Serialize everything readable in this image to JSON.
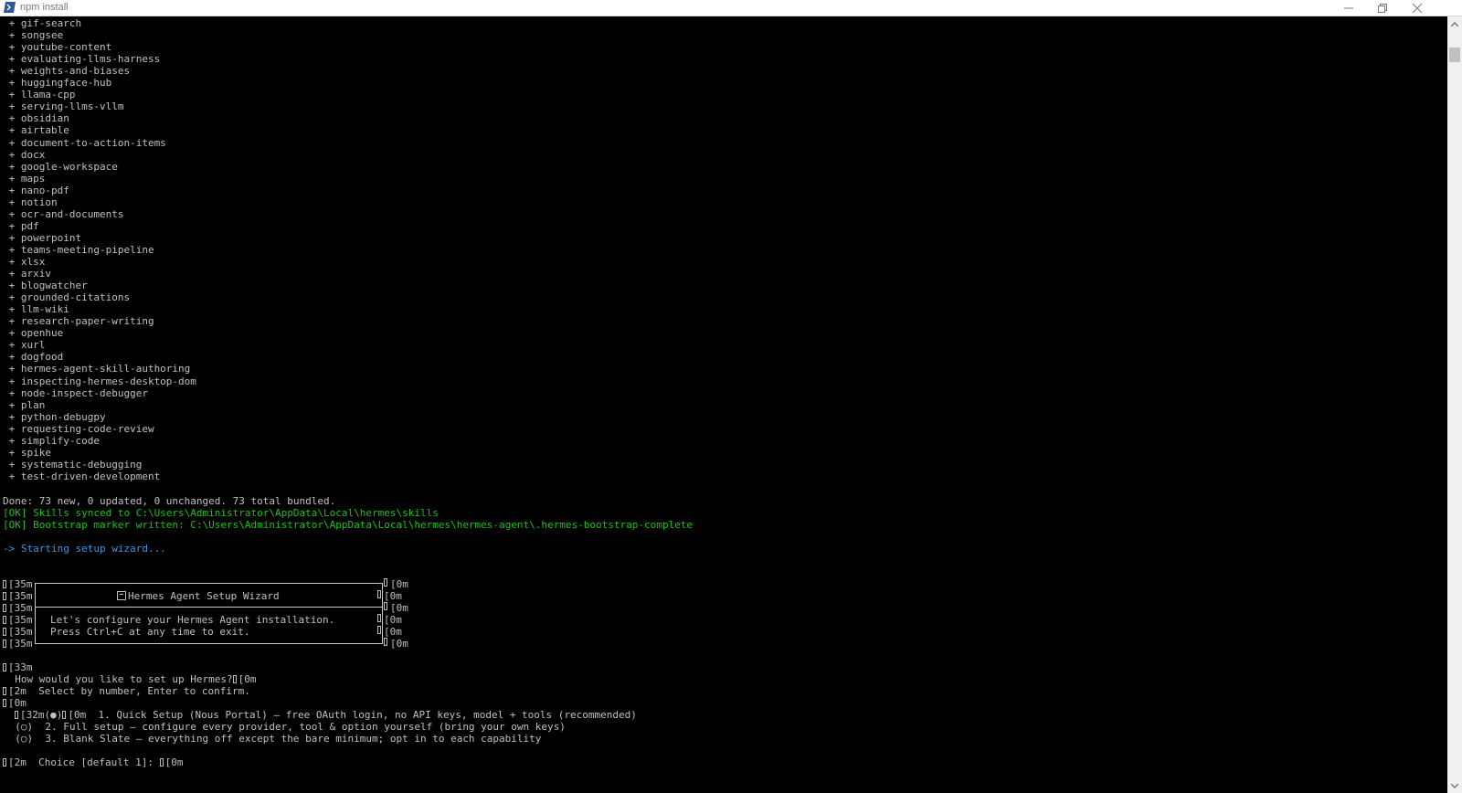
{
  "window": {
    "title": "npm install",
    "controls": {
      "minimize": "—",
      "restore": "❐",
      "close": "✕"
    }
  },
  "skills": [
    "gif-search",
    "songsee",
    "youtube-content",
    "evaluating-llms-harness",
    "weights-and-biases",
    "huggingface-hub",
    "llama-cpp",
    "serving-llms-vllm",
    "obsidian",
    "airtable",
    "document-to-action-items",
    "docx",
    "google-workspace",
    "maps",
    "nano-pdf",
    "notion",
    "ocr-and-documents",
    "pdf",
    "powerpoint",
    "teams-meeting-pipeline",
    "xlsx",
    "arxiv",
    "blogwatcher",
    "grounded-citations",
    "llm-wiki",
    "research-paper-writing",
    "openhue",
    "xurl",
    "dogfood",
    "hermes-agent-skill-authoring",
    "inspecting-hermes-desktop-dom",
    "node-inspect-debugger",
    "plan",
    "python-debugpy",
    "requesting-code-review",
    "simplify-code",
    "spike",
    "systematic-debugging",
    "test-driven-development"
  ],
  "skill_prefix": " + ",
  "summary": "Done: 73 new, 0 updated, 0 unchanged. 73 total bundled.",
  "ok_lines": [
    "[OK] Skills synced to C:\\Users\\Administrator\\AppData\\Local\\hermes\\skills",
    "[OK] Bootstrap marker written: C:\\Users\\Administrator\\AppData\\Local\\hermes\\hermes-agent\\.hermes-bootstrap-complete"
  ],
  "starting": "-> Starting setup wizard...",
  "box": {
    "left_code": "[35m",
    "right_code": "[0m",
    "title": "Hermes Agent Setup Wizard",
    "body": [
      "Let's configure your Hermes Agent installation.",
      "Press Ctrl+C at any time to exit."
    ]
  },
  "prompt": {
    "yellow_code": "[33m",
    "question": "  How would you like to set up Hermes?",
    "reset_code": "[0m",
    "hint": "[2m  Select by number, Enter to confirm.",
    "reset_line": "[0m",
    "options": [
      {
        "pre": "[32m(●)",
        "mid": "[0m",
        "text": "  1. Quick Setup (Nous Portal) — free OAuth login, no API keys, model + tools (recommended)"
      },
      {
        "text": "  (○)  2. Full setup — configure every provider, tool & option yourself (bring your own keys)"
      },
      {
        "text": "  (○)  3. Blank Slate — everything off except the bare minimum; opt in to each capability"
      }
    ],
    "choice": "[2m  Choice [default 1]: ",
    "choice_end": "[0m"
  }
}
